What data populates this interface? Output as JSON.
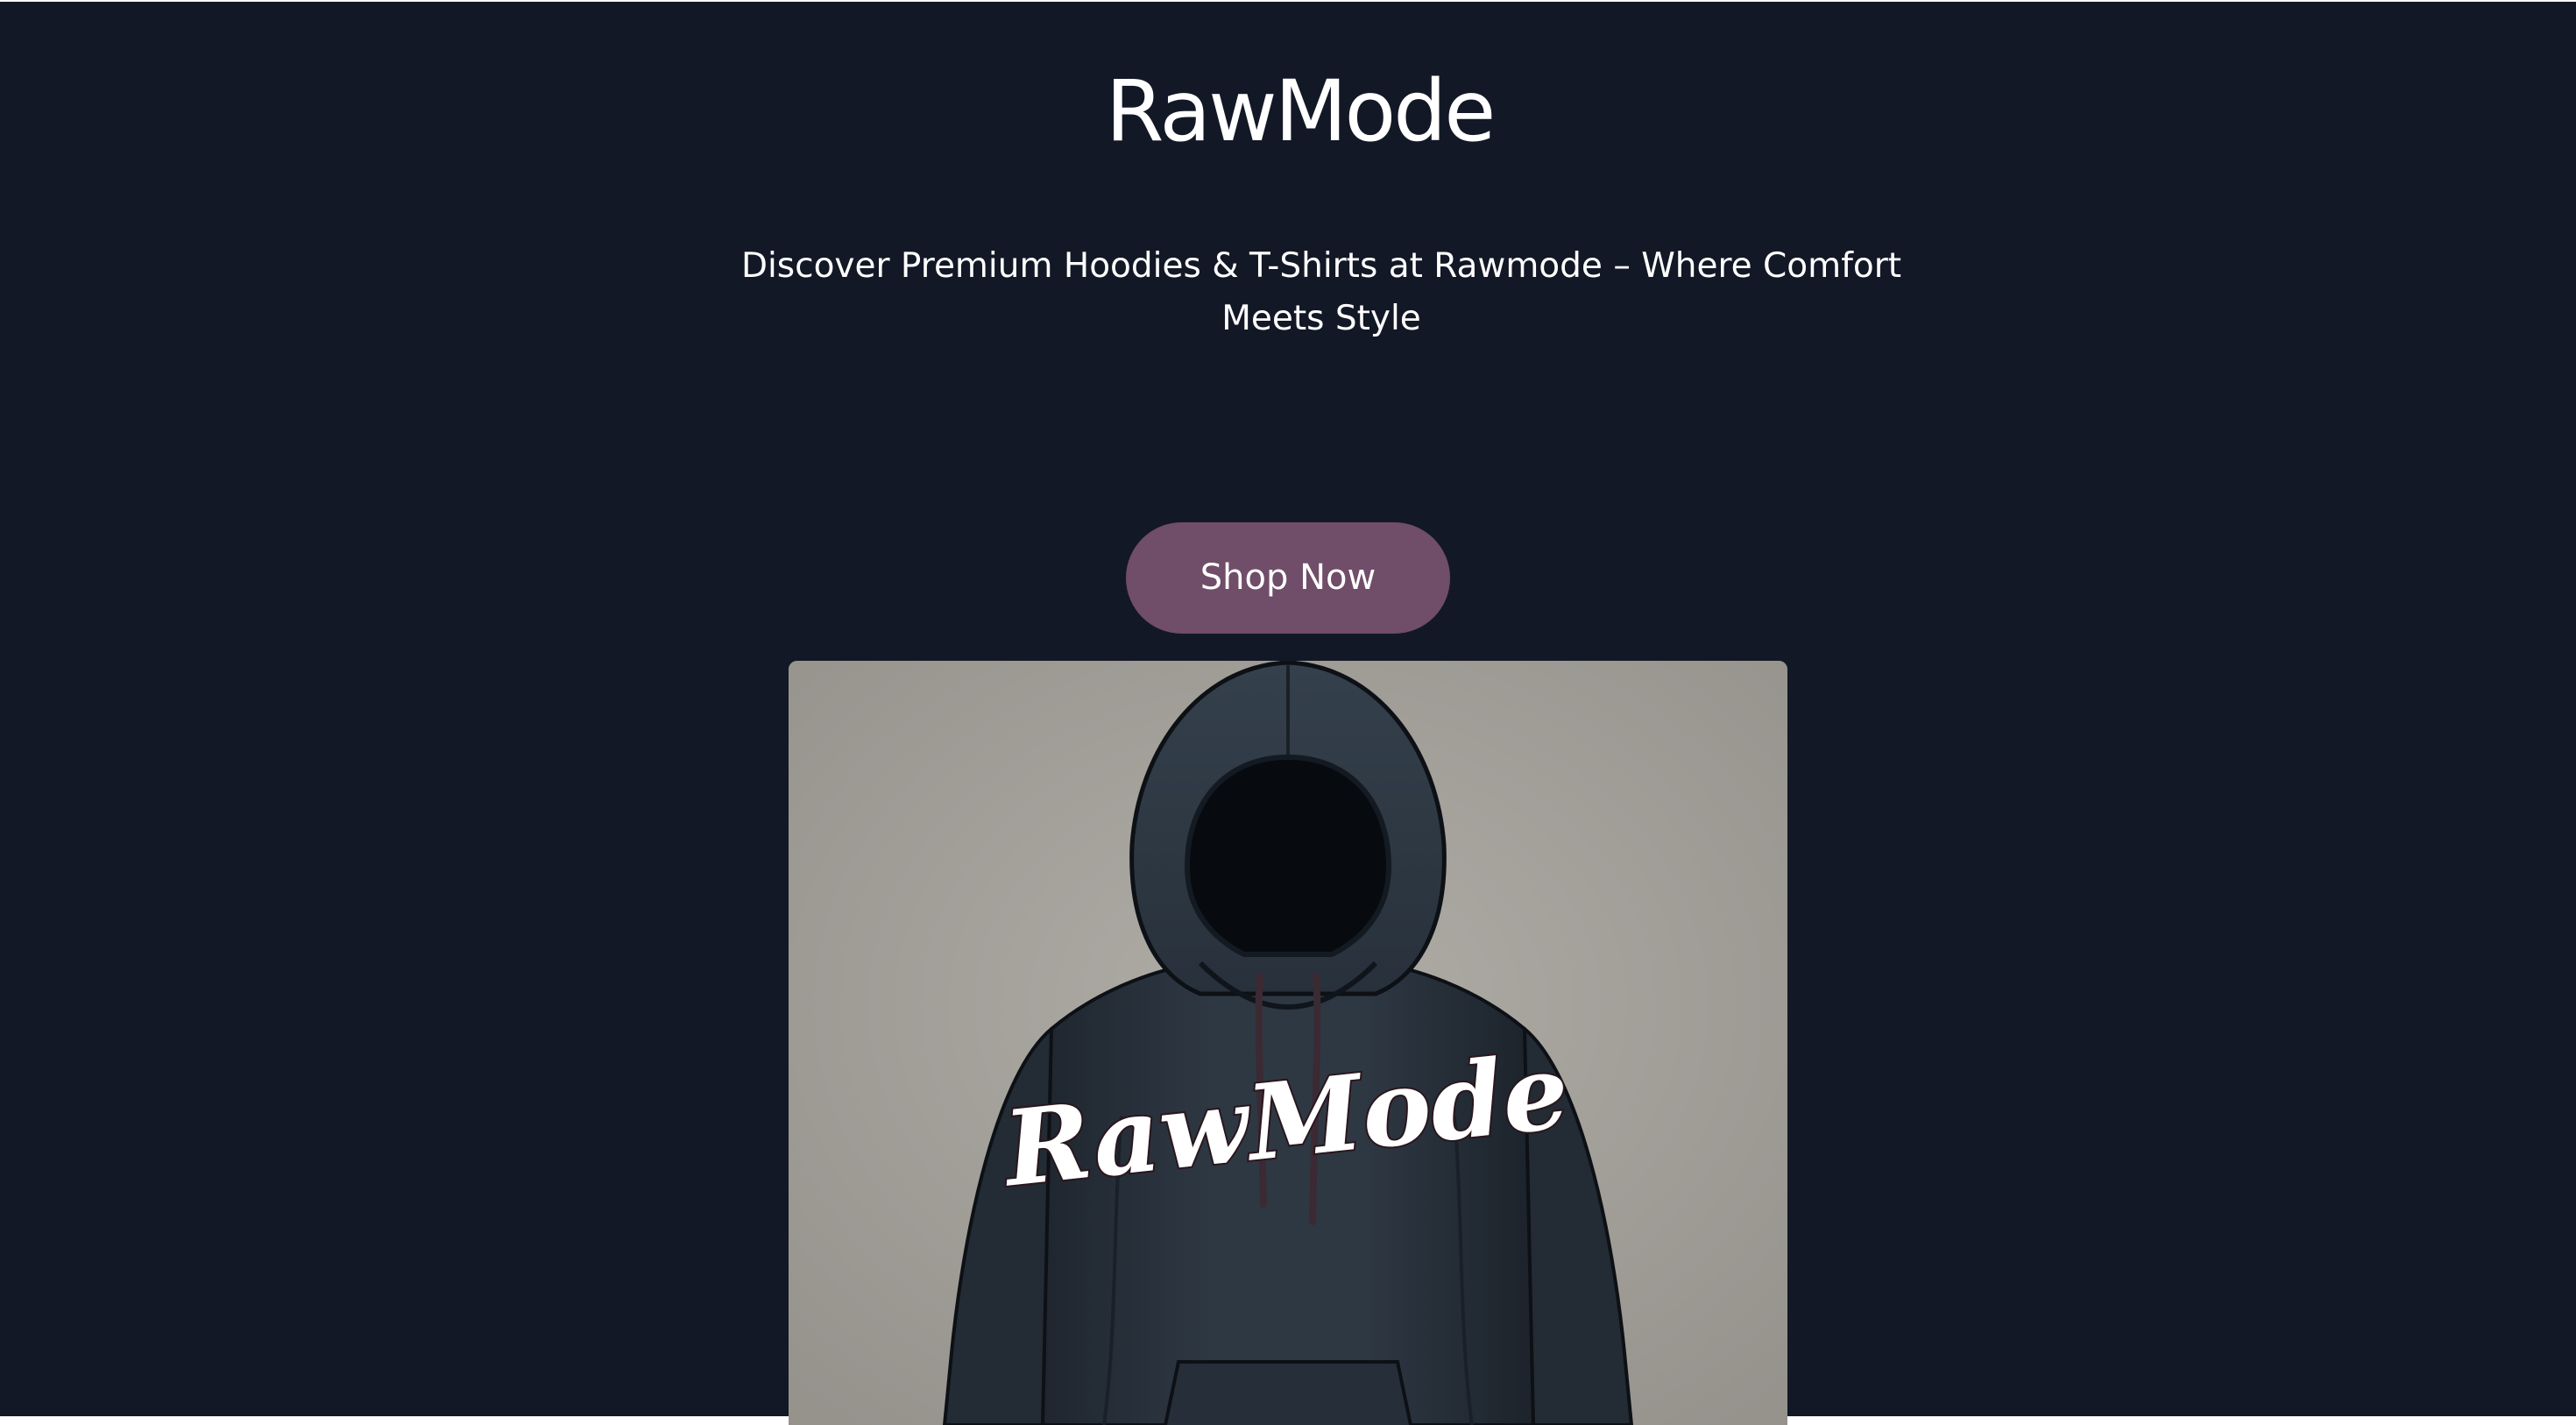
{
  "brand": {
    "name": "RawMode"
  },
  "hero": {
    "tagline": "Discover Premium Hoodies & T-Shirts at Rawmode – Where Comfort Meets Style",
    "cta_label": "Shop Now",
    "image_logo_text": "RawMode"
  },
  "colors": {
    "background": "#131826",
    "cta": "#704d69",
    "text": "#ffffff",
    "image_backdrop": "#a29f99",
    "hoodie": "#2c3540"
  }
}
